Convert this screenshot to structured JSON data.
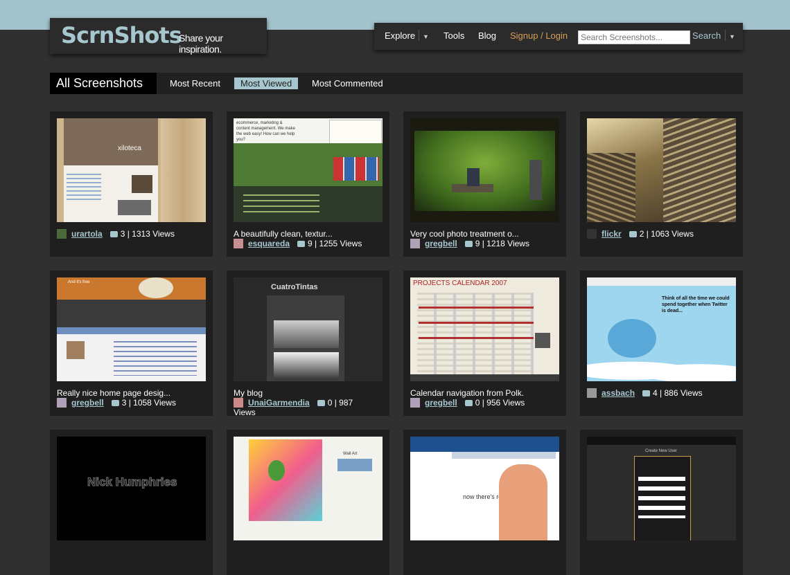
{
  "header": {
    "brand": "ScrnShots",
    "tagline": "Share your inspiration."
  },
  "nav": {
    "explore": "Explore",
    "tools": "Tools",
    "blog": "Blog",
    "signup": "Signup / Login",
    "search_placeholder": "Search Screenshots...",
    "search_button": "Search"
  },
  "tabs": {
    "all": "All Screenshots",
    "recent": "Most Recent",
    "viewed": "Most Viewed",
    "commented": "Most Commented"
  },
  "cards": [
    {
      "caption": "",
      "user": "urartola",
      "stats": "3 | 1313 Views",
      "thumb_text": "xiloteca"
    },
    {
      "caption": "A beautifully clean, textur...",
      "user": "esquareda",
      "stats": "9 | 1255 Views",
      "thumb_text": "ecommerce, marketing & content management. We make the web easy! How can we help you?"
    },
    {
      "caption": "Very cool photo treatment o...",
      "user": "gregbell",
      "stats": "9 | 1218 Views",
      "thumb_text": ""
    },
    {
      "caption": "",
      "user": "flickr",
      "stats": "2 | 1063 Views",
      "thumb_text": ""
    },
    {
      "caption": "Really nice home page desig...",
      "user": "gregbell",
      "stats": "3 | 1058 Views",
      "thumb_text": "And it's free"
    },
    {
      "caption": "My blog",
      "user": "UnaiGarmendia",
      "stats": "0 | 987",
      "stats_extra": "Views",
      "thumb_text": "CuatroTintas"
    },
    {
      "caption": "Calendar navigation from Polk.",
      "user": "gregbell",
      "stats": "0 | 956 Views",
      "thumb_text": "PROJECTS CALENDAR 2007"
    },
    {
      "caption": "",
      "user": "assbach",
      "stats": "4 | 886 Views",
      "thumb_text": "Think of all the time we could spend together when Twitter is dead..."
    },
    {
      "thumb_text": "Nick Humphries"
    },
    {
      "thumb_text": "Wall Art"
    },
    {
      "thumb_text": "now there's reQall."
    },
    {
      "thumb_text": "Create New User"
    }
  ],
  "colors": {
    "accent": "#a7c7cf",
    "topband": "#a3c4cc",
    "background": "#303030",
    "signup": "#d99f59"
  }
}
